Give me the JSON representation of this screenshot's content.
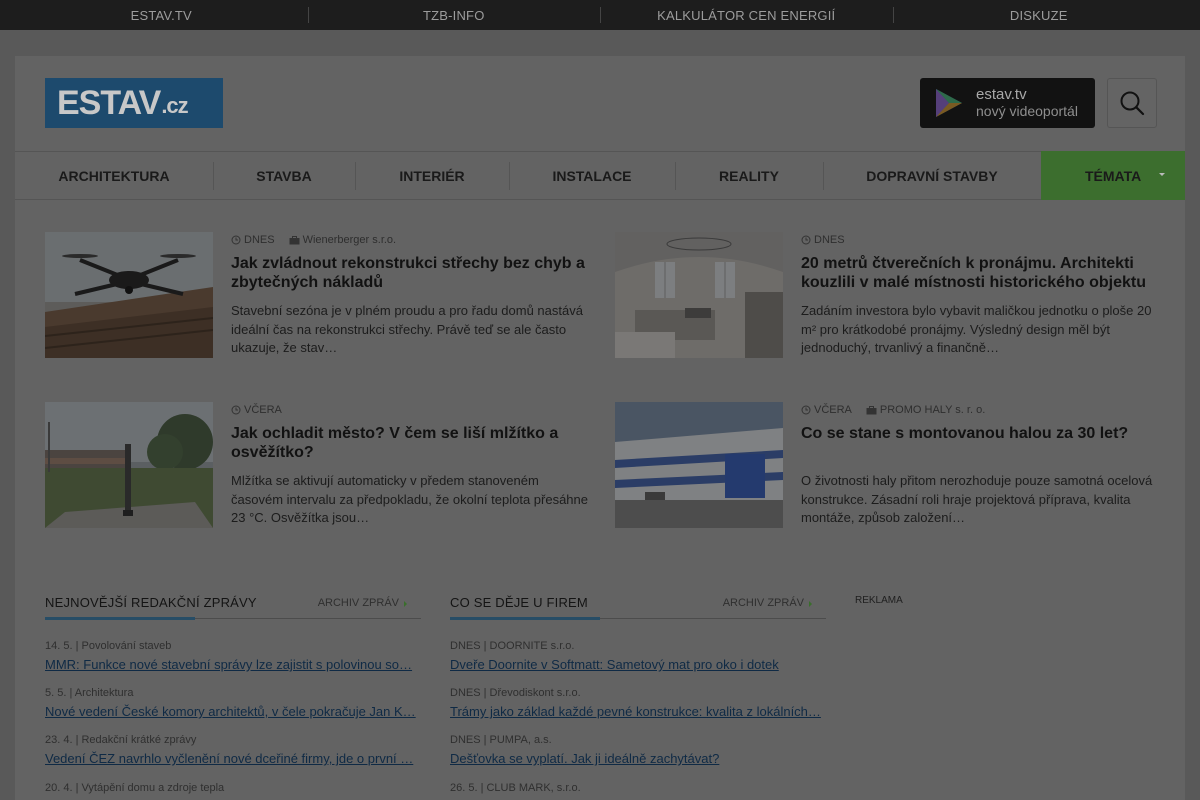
{
  "topbar": {
    "links": [
      "ESTAV.TV",
      "TZB-INFO",
      "KALKULÁTOR CEN ENERGIÍ",
      "DISKUZE"
    ]
  },
  "header": {
    "logo_main": "ESTAV",
    "logo_suffix": ".cz",
    "tv_title": "estav.tv",
    "tv_subtitle": "nový videoportál"
  },
  "nav": {
    "items": [
      "ARCHITEKTURA",
      "STAVBA",
      "INTERIÉR",
      "INSTALACE",
      "REALITY",
      "DOPRAVNÍ STAVBY"
    ],
    "temata": "TÉMATA"
  },
  "articles": [
    {
      "date": "DNES",
      "company": "Wienerberger s.r.o.",
      "title": "Jak zvládnout rekonstrukci střechy bez chyb a zbytečných nákladů",
      "perex": "Stavební sezóna je v plném proudu a pro řadu domů nastává ideální čas na rekonstrukci střechy. Právě teď se ale často ukazuje, že stav…"
    },
    {
      "date": "DNES",
      "company": "",
      "title": "20 metrů čtverečních k pronájmu. Architekti kouzlili v malé místnosti historického objektu",
      "perex": "Zadáním investora bylo vybavit maličkou jednotku o ploše 20 m² pro krátkodobé pronájmy. Výsledný design měl být jednoduchý, trvanlivý a finančně…"
    },
    {
      "date": "VČERA",
      "company": "",
      "title": "Jak ochladit město? V čem se liší mlžítko a osvěžítko?",
      "perex": "Mlžítka se aktivují automaticky v předem stanoveném časovém intervalu za předpokladu, že okolní teplota přesáhne 23 °C. Osvěžítka jsou…"
    },
    {
      "date": "VČERA",
      "company": "PROMO HALY s. r. o.",
      "title": "Co se stane s montovanou halou za 30 let?",
      "perex": "O životnosti haly přitom nerozhoduje pouze samotná ocelová konstrukce. Zásadní roli hraje projektová příprava, kvalita montáže, způsob založení…"
    }
  ],
  "news": {
    "title": "NEJNOVĚJŠÍ REDAKČNÍ ZPRÁVY",
    "archive": "ARCHIV ZPRÁV",
    "items": [
      {
        "meta": "14. 5. | Povolování staveb",
        "link": "MMR: Funkce nové stavební správy lze zajistit s polovinou so…"
      },
      {
        "meta": "5. 5. | Architektura",
        "link": "Nové vedení České komory architektů, v čele pokračuje Jan K…"
      },
      {
        "meta": "23. 4. | Redakční krátké zprávy",
        "link": "Vedení ČEZ navrhlo vyčlenění nové dceřiné firmy, jde o první …"
      },
      {
        "meta": "20. 4. | Vytápění domu a zdroje tepla",
        "link": ""
      }
    ]
  },
  "firms": {
    "title": "CO SE DĚJE U FIREM",
    "archive": "ARCHIV ZPRÁV",
    "items": [
      {
        "meta": "DNES | DOORNITE s.r.o.",
        "link": "Dveře Doornite v Softmatt: Sametový mat pro oko i dotek"
      },
      {
        "meta": "DNES | Dřevodiskont s.r.o.",
        "link": "Trámy jako základ každé pevné konstrukce: kvalita z lokálních…"
      },
      {
        "meta": "DNES | PUMPA, a.s.",
        "link": "Dešťovka se vyplatí. Jak ji ideálně zachytávat?"
      },
      {
        "meta": "26. 5. | CLUB MARK, s.r.o.",
        "link": ""
      }
    ]
  },
  "ad_label": "REKLAMA"
}
